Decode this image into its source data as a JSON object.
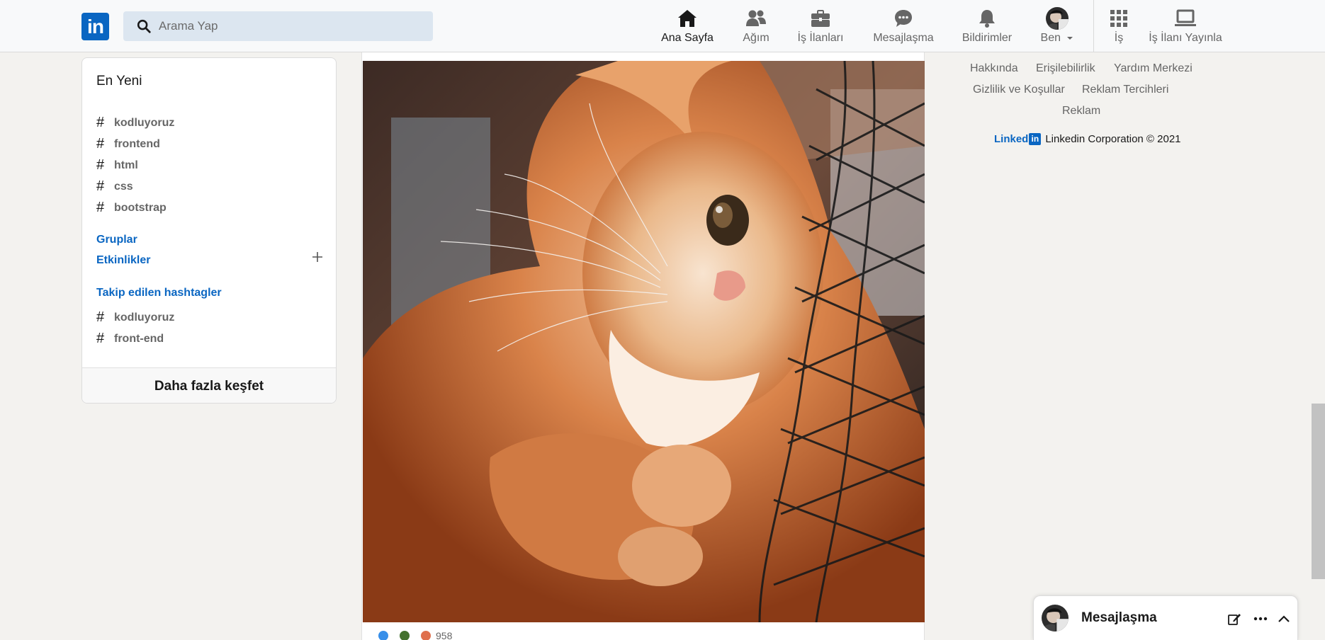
{
  "header": {
    "logo_text": "in",
    "search_placeholder": "Arama Yap",
    "nav": [
      {
        "label": "Ana Sayfa",
        "icon": "home-icon"
      },
      {
        "label": "Ağım",
        "icon": "people-icon"
      },
      {
        "label": "İş İlanları",
        "icon": "briefcase-icon"
      },
      {
        "label": "Mesajlaşma",
        "icon": "chat-icon"
      },
      {
        "label": "Bildirimler",
        "icon": "bell-icon"
      },
      {
        "label": "Ben",
        "icon": "avatar"
      },
      {
        "label": "İş",
        "icon": "grid-icon"
      },
      {
        "label": "İş İlanı Yayınla",
        "icon": "laptop-icon"
      }
    ]
  },
  "sidebar": {
    "recent_title": "En Yeni",
    "recent_tags": [
      "kodluyoruz",
      "frontend",
      "html",
      "css",
      "bootstrap"
    ],
    "groups_label": "Gruplar",
    "events_label": "Etkinlikler",
    "followed_label": "Takip edilen hashtagler",
    "followed_tags": [
      "kodluyoruz",
      "front-end"
    ],
    "discover_label": "Daha fazla keşfet",
    "hash_symbol": "#"
  },
  "post": {
    "image_alt": "orange cat",
    "reaction_count": "958"
  },
  "footer": {
    "links_row1": [
      "Hakkında",
      "Erişilebilirlik",
      "Yardım Merkezi"
    ],
    "links_row2": [
      "Gizlilik ve Koşullar",
      "Reklam Tercihleri"
    ],
    "links_row3": [
      "Reklam"
    ],
    "brand_word": "Linked",
    "brand_in": "in",
    "copyright": "Linkedin Corporation © 2021"
  },
  "messaging": {
    "title": "Mesajlaşma"
  },
  "colors": {
    "brand": "#0a66c2",
    "background": "#f3f2ef",
    "search_bg": "#dce6f0"
  }
}
